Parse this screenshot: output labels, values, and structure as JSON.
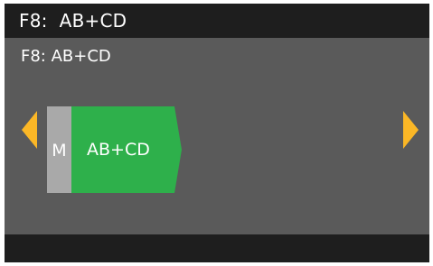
{
  "header": {
    "title": "F8:  AB+CD"
  },
  "subtitle": "F8: AB+CD",
  "selector": {
    "mode_letter": "M",
    "function_label": "AB+CD",
    "left_arrow_icon": "chevron-left-icon",
    "right_arrow_icon": "chevron-right-icon"
  },
  "colors": {
    "background": "#5a5a5a",
    "bar": "#1e1e1e",
    "accent_arrow": "#fbb726",
    "mode_block": "#a9a9a9",
    "function_tag": "#2eb04b"
  }
}
